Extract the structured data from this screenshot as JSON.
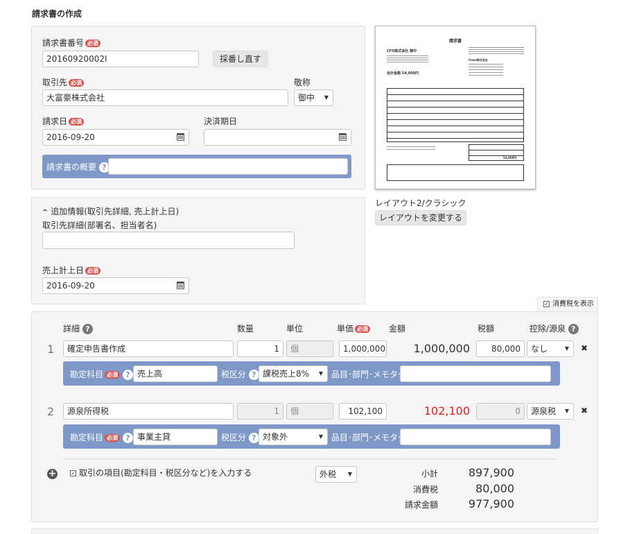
{
  "page_title": "請求書の作成",
  "required_badge": "必須",
  "invoice": {
    "number_label": "請求書番号",
    "number_value": "20160920002I",
    "renumber_button": "採番し直す",
    "client_label": "取引先",
    "client_value": "大富豪株式会社",
    "honorific_label": "敬称",
    "honorific_value": "御中",
    "date_label": "請求日",
    "date_value": "2016-09-20",
    "due_label": "決済期日",
    "due_value": "",
    "summary_label": "請求書の概要",
    "summary_value": ""
  },
  "extra": {
    "toggle_label": "追加情報(取引先詳細, 売上計上日)",
    "client_detail_label": "取引先詳細(部署名、担当者名)",
    "client_detail_value": "",
    "sales_date_label": "売上計上日",
    "sales_date_value": "2016-09-20"
  },
  "preview": {
    "caption": "レイアウト2/クラシック",
    "change_button": "レイアウトを変更する",
    "doc_title": "請求書",
    "doc_client": "CFO株式会社 御中",
    "doc_total": "合計金額 54,000円",
    "doc_company": "freee株式会社",
    "doc_grand": "54,000円"
  },
  "tax_display": "消費税を表示",
  "columns": {
    "detail": "詳細",
    "qty": "数量",
    "unit": "単位",
    "price": "単価",
    "amount": "金額",
    "tax": "税額",
    "deduct": "控除/源泉"
  },
  "lines": [
    {
      "no": "1",
      "detail": "確定申告書作成",
      "qty": "1",
      "unit": "個",
      "price": "1,000,000",
      "amount": "1,000,000",
      "tax": "80,000",
      "deduct": "なし",
      "account_label": "勘定科目",
      "account": "売上高",
      "tax_cat_label": "税区分",
      "tax_cat": "課税売上8%",
      "memo_label": "品目･部門･メモタグ",
      "memo": ""
    },
    {
      "no": "2",
      "detail": "源泉所得税",
      "qty": "1",
      "unit": "個",
      "price": "102,100",
      "amount": "102,100",
      "tax": "0",
      "deduct": "源泉税",
      "account_label": "勘定科目",
      "account": "事業主貸",
      "tax_cat_label": "税区分",
      "tax_cat": "対象外",
      "memo_label": "品目･部門･メモタグ",
      "memo": ""
    }
  ],
  "footer": {
    "enter_items_label": "取引の項目(勘定科目・税区分など)を入力する",
    "tax_mode": "外税",
    "subtotal_label": "小計",
    "subtotal": "897,900",
    "tax_label": "消費税",
    "tax": "80,000",
    "total_label": "請求金額",
    "total": "977,900"
  },
  "colors": {
    "accent_blue": "#7e98c7",
    "required_red": "#d9534f",
    "negative_red": "#e0201f"
  }
}
